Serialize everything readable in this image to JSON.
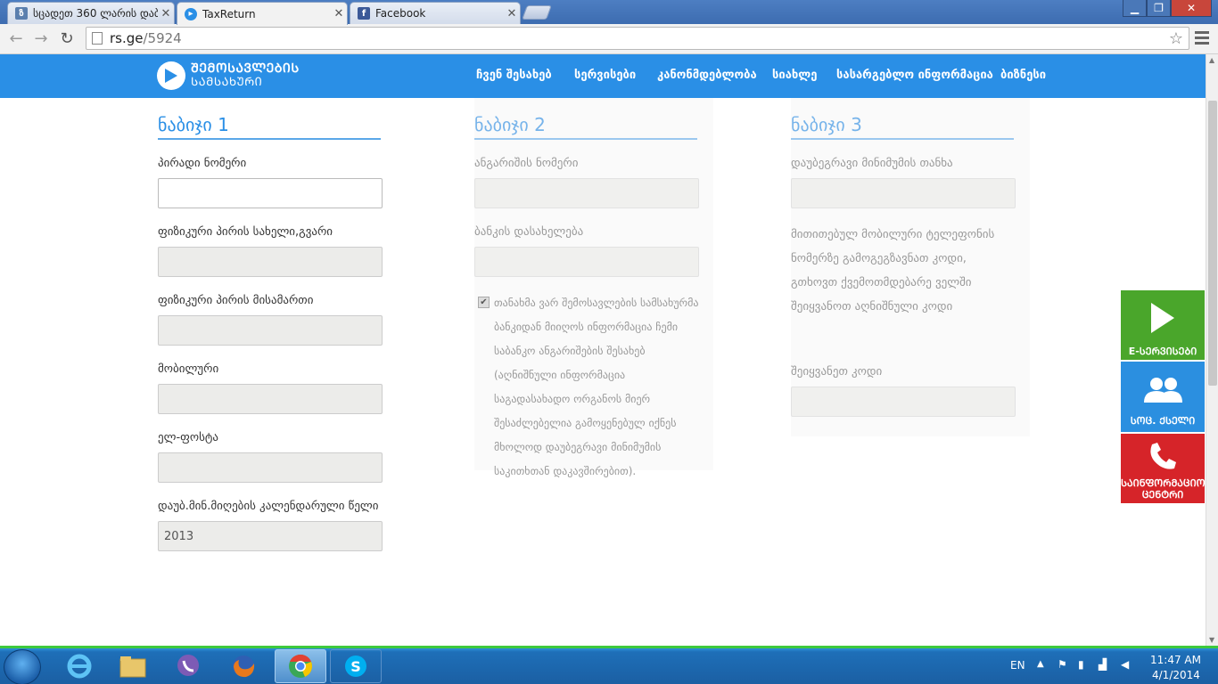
{
  "browser": {
    "tabs": [
      {
        "label": "სცადეთ 360 ლარის დაბრ",
        "active": false
      },
      {
        "label": "TaxReturn",
        "active": true
      },
      {
        "label": "Facebook",
        "active": false
      }
    ],
    "url_host": "rs.ge",
    "url_path": "/5924"
  },
  "site": {
    "logo_line1": "ᲨᲔᲛᲝᲡᲐᲕᲚᲔᲑᲘᲡ",
    "logo_line2": "ᲡᲐᲛᲡᲐᲮᲣᲠᲘ",
    "nav": [
      "ჩვენ შესახებ",
      "სერვისები",
      "კანონმდებლობა",
      "სიახლე",
      "სასარგებლო ინფორმაცია",
      "ბიზნესი"
    ]
  },
  "step1": {
    "title": "ნაბიჯი 1",
    "fields": [
      {
        "label": "პირადი ნომერი",
        "value": ""
      },
      {
        "label": "ფიზიკური პირის სახელი,გვარი",
        "value": ""
      },
      {
        "label": "ფიზიკური პირის მისამართი",
        "value": ""
      },
      {
        "label": "მობილური",
        "value": ""
      },
      {
        "label": "ელ-ფოსტა",
        "value": ""
      },
      {
        "label": "დაუბ.მინ.მიღების კალენდარული წელი",
        "value": "2013"
      }
    ]
  },
  "step2": {
    "title": "ნაბიჯი 2",
    "fields": [
      {
        "label": "ანგარიშის ნომერი",
        "value": ""
      },
      {
        "label": "ბანკის დასახელება",
        "value": ""
      }
    ],
    "consent_checked": true,
    "consent_text": "თანახმა ვარ შემოსავლების სამსახურმა ბანკიდან მიიღოს ინფორმაცია ჩემი საბანკო ანგარიშების შესახებ (აღნიშნული ინფორმაცია საგადასახადო ორგანოს მიერ შესაძლებელია გამოყენებულ იქნეს მხოლოდ დაუბეგრავი მინიმუმის საკითხთან დაკავშირებით)."
  },
  "step3": {
    "title": "ნაბიჯი 3",
    "amount_label": "დაუბეგრავი მინიმუმის თანხა",
    "amount_value": "",
    "info_text": "მითითებულ მობილური ტელეფონის ნომერზე გამოგეგზავნათ კოდი, გთხოვთ ქვემოთმდებარე ველში შეიყვანოთ აღნიშნული კოდი",
    "code_label": "შეიყვანეთ კოდი",
    "code_value": ""
  },
  "side_widgets": [
    {
      "label": "E-ᲡᲔᲠᲕᲘᲡᲔᲑᲘ",
      "color": "#4aa62b",
      "icon": "play-icon"
    },
    {
      "label": "ᲡᲝᲪ. ᲥᲡᲔᲚᲘ",
      "color": "#2b8fe0",
      "icon": "people-icon"
    },
    {
      "label": "ᲡᲐᲘᲜᲤᲝᲠᲛᲐᲪᲘᲝ ᲪᲔᲜᲢᲠᲘ",
      "color": "#d62429",
      "icon": "phone-icon"
    }
  ],
  "taskbar": {
    "lang": "EN",
    "time": "11:47 AM",
    "date": "4/1/2014"
  }
}
